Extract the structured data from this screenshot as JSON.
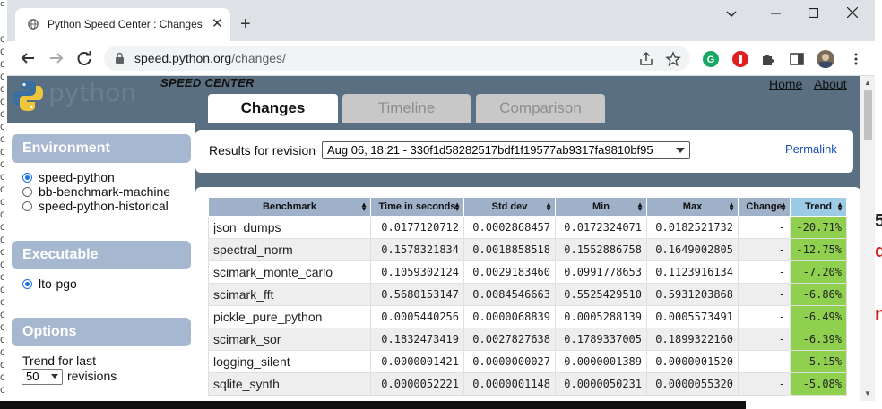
{
  "browser": {
    "tab_title": "Python Speed Center : Changes",
    "url_host": "speed.python.org",
    "url_path": "/changes/"
  },
  "site": {
    "logo_text": "python",
    "title": "SPEED CENTER",
    "links": [
      "Home",
      "About"
    ]
  },
  "nav_tabs": [
    {
      "label": "Changes",
      "active": true
    },
    {
      "label": "Timeline",
      "active": false
    },
    {
      "label": "Comparison",
      "active": false
    }
  ],
  "environment": {
    "heading": "Environment",
    "options": [
      {
        "label": "speed-python",
        "checked": true
      },
      {
        "label": "bb-benchmark-machine",
        "checked": false
      },
      {
        "label": "speed-python-historical",
        "checked": false
      }
    ]
  },
  "executable": {
    "heading": "Executable",
    "options": [
      {
        "label": "lto-pgo",
        "checked": true
      }
    ]
  },
  "options": {
    "heading": "Options",
    "trend_label": "Trend for last",
    "trend_value": "50",
    "revisions_label": "revisions"
  },
  "revision": {
    "label": "Results for revision",
    "selected": "Aug 06, 18:21 - 330f1d58282517bdf1f19577ab9317fa9810bf95",
    "permalink": "Permalink"
  },
  "table": {
    "columns": [
      "Benchmark",
      "Time in seconds",
      "Std dev",
      "Min",
      "Max",
      "Change",
      "Trend"
    ],
    "rows": [
      {
        "name": "json_dumps",
        "time": "0.0177120712",
        "std": "0.0002868457",
        "min": "0.0172324071",
        "max": "0.0182521732",
        "change": "-",
        "trend": "-20.71%"
      },
      {
        "name": "spectral_norm",
        "time": "0.1578321834",
        "std": "0.0018858518",
        "min": "0.1552886758",
        "max": "0.1649002805",
        "change": "-",
        "trend": "-12.75%"
      },
      {
        "name": "scimark_monte_carlo",
        "time": "0.1059302124",
        "std": "0.0029183460",
        "min": "0.0991778653",
        "max": "0.1123916134",
        "change": "-",
        "trend": "-7.20%"
      },
      {
        "name": "scimark_fft",
        "time": "0.5680153147",
        "std": "0.0084546663",
        "min": "0.5525429510",
        "max": "0.5931203868",
        "change": "-",
        "trend": "-6.86%"
      },
      {
        "name": "pickle_pure_python",
        "time": "0.0005440256",
        "std": "0.0000068839",
        "min": "0.0005288139",
        "max": "0.0005573491",
        "change": "-",
        "trend": "-6.49%"
      },
      {
        "name": "scimark_sor",
        "time": "0.1832473419",
        "std": "0.0027827638",
        "min": "0.1789337005",
        "max": "0.1899322160",
        "change": "-",
        "trend": "-6.39%"
      },
      {
        "name": "logging_silent",
        "time": "0.0000001421",
        "std": "0.0000000027",
        "min": "0.0000001389",
        "max": "0.0000001520",
        "change": "-",
        "trend": "-5.15%"
      },
      {
        "name": "sqlite_synth",
        "time": "0.0000052221",
        "std": "0.0000001148",
        "min": "0.0000050231",
        "max": "0.0000055320",
        "change": "-",
        "trend": "-5.08%"
      }
    ]
  },
  "colors": {
    "page_bg": "#5b6f82",
    "box_header": "#a6b8d0",
    "trend_green": "#8fd14f",
    "permalink": "#1a4fb0"
  }
}
